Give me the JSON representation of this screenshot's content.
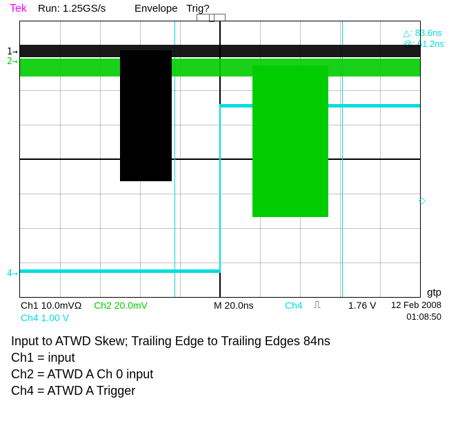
{
  "scope": {
    "brand": "Tek",
    "run": "Run: 1.25GS/s",
    "envelope": "Envelope",
    "trig_q": "Trig?",
    "cursor_delta": "△: 83.6ns",
    "cursor_at": "@:  61.2ns",
    "ch_labels": {
      "ch1": "1→",
      "ch2": "2→",
      "ch4": "4→"
    },
    "ch1": "Ch1   10.0mVΩ",
    "ch2": "Ch2   20.0mV",
    "ch4line2": "Ch4   1.00 V",
    "timebase": "M 20.0ns",
    "ch4": "Ch4",
    "slope": "␍",
    "trig_level": "1.76 V",
    "gtp": "gtp",
    "date": "12 Feb 2008",
    "time": "01:08:50"
  },
  "annotation": {
    "title": "Input to ATWD Skew; Trailing Edge to Trailing Edges 84ns",
    "ch1": "Ch1 = input",
    "ch2": "Ch2 = ATWD A Ch 0 input",
    "ch4": "Ch4 = ATWD A Trigger"
  },
  "chart_data": {
    "type": "line",
    "instrument": "Tektronix oscilloscope (envelope persistence)",
    "timebase_ns_per_div": 20.0,
    "sample_rate": "1.25GS/s",
    "x_window_ns": [
      -100,
      100
    ],
    "cursors_ns": {
      "a": -22.4,
      "b": 61.2,
      "delta": 83.6
    },
    "series": [
      {
        "name": "Ch1",
        "color": "#000",
        "coupling": "10.0mVΩ",
        "baseline_div": 3.2,
        "pulse": {
          "t_start_ns": -50,
          "t_end_ns": -24,
          "amplitude_div": -4.6
        }
      },
      {
        "name": "Ch2",
        "color": "#00cc00",
        "coupling": "20.0mV",
        "baseline_div": 2.9,
        "pulse": {
          "t_start_ns": 16,
          "t_end_ns": 54,
          "amplitude_div": -5.5
        }
      },
      {
        "name": "Ch4",
        "color": "#00dddd",
        "coupling": "1.00 V",
        "trigger_level_V": 1.76,
        "low_div": -4.0,
        "high_div": 2.0,
        "edge_t_ns": 0
      }
    ],
    "grid_divisions": {
      "x": 10,
      "y": 8
    },
    "annotations": [
      "trailing-edge skew Ch1→Ch2 ≈ 84 ns"
    ]
  }
}
